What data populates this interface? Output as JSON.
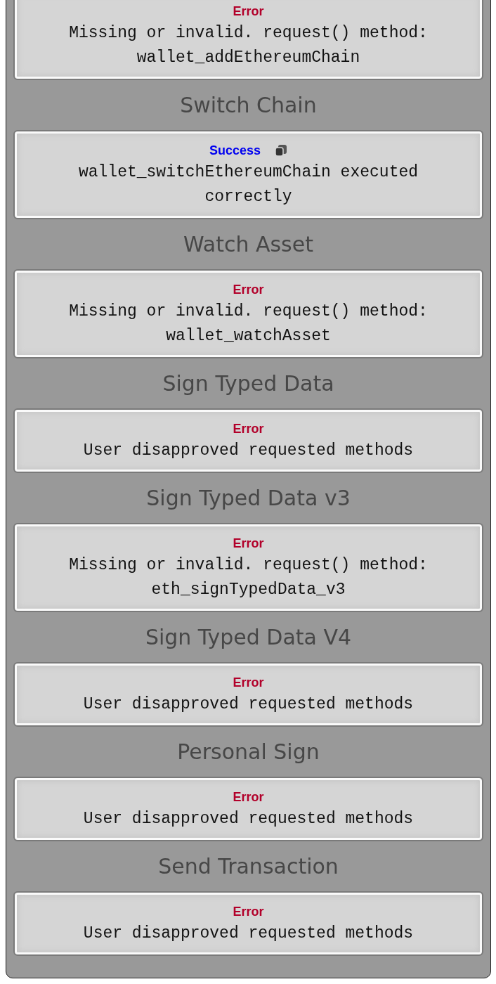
{
  "sections": [
    {
      "result": {
        "status": {
          "kind": "error",
          "label": "Error"
        },
        "copyable": false,
        "message": "Missing or invalid. request() method: wallet_addEthereumChain"
      }
    },
    {
      "title": "Switch Chain",
      "result": {
        "status": {
          "kind": "success",
          "label": "Success"
        },
        "copyable": true,
        "message": "wallet_switchEthereumChain executed correctly"
      }
    },
    {
      "title": "Watch Asset",
      "result": {
        "status": {
          "kind": "error",
          "label": "Error"
        },
        "copyable": false,
        "message": "Missing or invalid. request() method: wallet_watchAsset"
      }
    },
    {
      "title": "Sign Typed Data",
      "result": {
        "status": {
          "kind": "error",
          "label": "Error"
        },
        "copyable": false,
        "message": "User disapproved requested methods"
      }
    },
    {
      "title": "Sign Typed Data v3",
      "result": {
        "status": {
          "kind": "error",
          "label": "Error"
        },
        "copyable": false,
        "message": "Missing or invalid. request() method: eth_signTypedData_v3"
      }
    },
    {
      "title": "Sign Typed Data V4",
      "result": {
        "status": {
          "kind": "error",
          "label": "Error"
        },
        "copyable": false,
        "message": "User disapproved requested methods"
      }
    },
    {
      "title": "Personal Sign",
      "result": {
        "status": {
          "kind": "error",
          "label": "Error"
        },
        "copyable": false,
        "message": "User disapproved requested methods"
      }
    },
    {
      "title": "Send Transaction",
      "result": {
        "status": {
          "kind": "error",
          "label": "Error"
        },
        "copyable": false,
        "message": "User disapproved requested methods"
      }
    }
  ]
}
